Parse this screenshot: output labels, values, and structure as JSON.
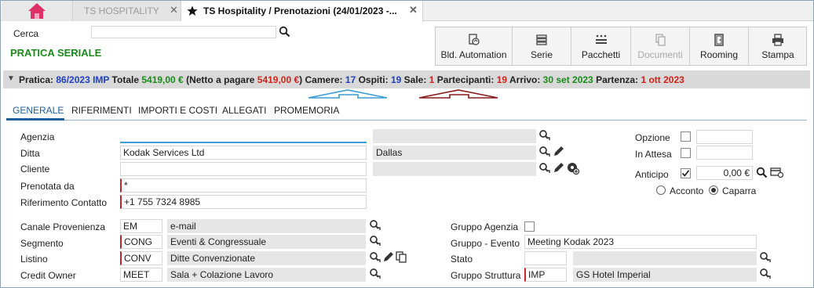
{
  "tabs": {
    "inactive_label": "TS HOSPITALITY",
    "active_label": "TS Hospitality / Prenotazioni (24/01/2023 -...",
    "close": "✕"
  },
  "search": {
    "label": "Cerca",
    "value": ""
  },
  "page_title": "PRATICA SERIALE",
  "toolbar": {
    "buttons": [
      {
        "label": "Bld. Automation",
        "icon": "refresh-doc-icon"
      },
      {
        "label": "Serie",
        "icon": "stack-icon"
      },
      {
        "label": "Pacchetti",
        "icon": "package-list-icon"
      },
      {
        "label": "Documenti",
        "icon": "documents-icon",
        "disabled": true
      },
      {
        "label": "Rooming",
        "icon": "door-icon"
      },
      {
        "label": "Stampa",
        "icon": "printer-icon"
      }
    ]
  },
  "summary": {
    "pratica_label": "Pratica:",
    "pratica_value": "86/2023 IMP",
    "totale_label": "Totale",
    "totale_value": "5419,00 €",
    "netto_open": "(Netto a pagare",
    "netto_value": "5419,00 €",
    "netto_close": ")",
    "camere_label": "Camere:",
    "camere_value": "17",
    "ospiti_label": "Ospiti:",
    "ospiti_value": "19",
    "sale_label": "Sale:",
    "sale_value": "1",
    "partecipanti_label": "Partecipanti:",
    "partecipanti_value": "19",
    "arrivo_label": "Arrivo:",
    "arrivo_value": "30 set 2023",
    "partenza_label": "Partenza:",
    "partenza_value": "1 ott 2023"
  },
  "form_tabs": [
    "GENERALE",
    "RIFERIMENTI",
    "IMPORTI E COSTI",
    "ALLEGATI",
    "PROMEMORIA"
  ],
  "fields": {
    "agenzia": {
      "label": "Agenzia",
      "value": "",
      "right": ""
    },
    "ditta": {
      "label": "Ditta",
      "value": "Kodak Services Ltd",
      "right": "Dallas"
    },
    "cliente": {
      "label": "Cliente",
      "value": "",
      "right": ""
    },
    "prenotata": {
      "label": "Prenotata da",
      "value": "*"
    },
    "riferimento": {
      "label": "Riferimento Contatto",
      "value": "+1 755 7324 8985"
    },
    "canale": {
      "label": "Canale Provenienza",
      "code": "EM",
      "desc": "e-mail"
    },
    "segmento": {
      "label": "Segmento",
      "code": "CONG",
      "desc": "Eventi & Congressuale"
    },
    "listino": {
      "label": "Listino",
      "code": "CONV",
      "desc": "Ditte Convenzionate"
    },
    "credit": {
      "label": "Credit Owner",
      "code": "MEET",
      "desc": "Sala + Colazione Lavoro"
    },
    "gruppo_agenzia": {
      "label": "Gruppo Agenzia"
    },
    "gruppo_evento": {
      "label": "Gruppo - Evento",
      "value": "Meeting Kodak 2023"
    },
    "stato": {
      "label": "Stato",
      "code": "",
      "desc": ""
    },
    "gruppo_struttura": {
      "label": "Gruppo Struttura",
      "code": "IMP",
      "desc": "GS Hotel Imperial"
    }
  },
  "options": {
    "opzione": "Opzione",
    "in_attesa": "In Attesa",
    "anticipo": "Anticipo",
    "anticipo_value": "0,00 €",
    "acconto": "Acconto",
    "caparra": "Caparra"
  },
  "colors": {
    "blue": "#1f3fbf",
    "green": "#1a8a1a",
    "red": "#d0211b",
    "home": "#e0306a",
    "arrow_blue": "#3a9ed6",
    "arrow_dark_red": "#8b1a1a"
  }
}
